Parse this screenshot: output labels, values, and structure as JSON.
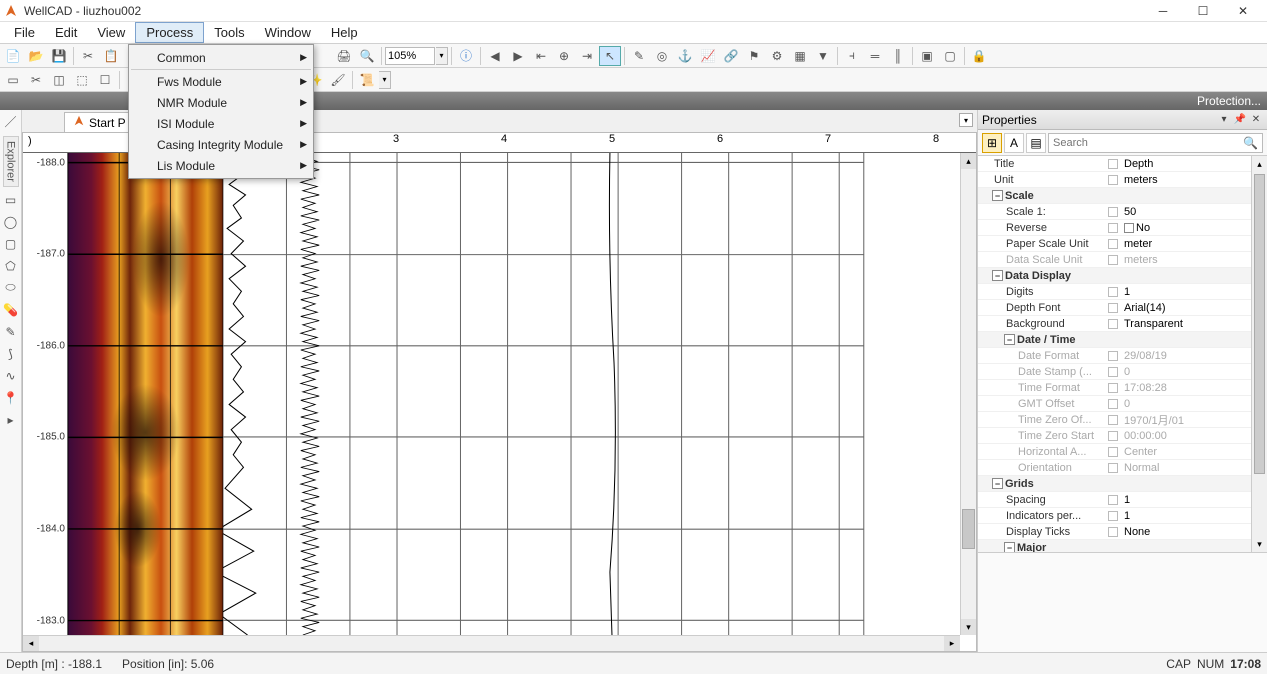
{
  "app": {
    "title": "WellCAD - liuzhou002"
  },
  "menubar": {
    "items": [
      "File",
      "Edit",
      "View",
      "Process",
      "Tools",
      "Window",
      "Help"
    ],
    "active": "Process"
  },
  "dropdown": {
    "items": [
      "Common",
      "Fws Module",
      "NMR Module",
      "ISI Module",
      "Casing Integrity Module",
      "Lis Module"
    ]
  },
  "zoom": {
    "value": "105%"
  },
  "tab": {
    "label": "Start P"
  },
  "protection": "Protection...",
  "ruler": {
    "ticks": [
      "3",
      "4",
      "5",
      "6",
      "7",
      "8"
    ]
  },
  "depths": [
    "-188.0",
    "-187.0",
    "-186.0",
    "-185.0",
    "-184.0",
    "-183.0"
  ],
  "properties": {
    "title": "Properties",
    "search_placeholder": "Search",
    "rows": {
      "title_k": "Title",
      "title_v": "Depth",
      "unit_k": "Unit",
      "unit_v": "meters",
      "scale_g": "Scale",
      "scale1_k": "Scale 1:",
      "scale1_v": "50",
      "reverse_k": "Reverse",
      "reverse_v": "No",
      "psu_k": "Paper Scale Unit",
      "psu_v": "meter",
      "dsu_k": "Data Scale Unit",
      "dsu_v": "meters",
      "dd_g": "Data Display",
      "digits_k": "Digits",
      "digits_v": "1",
      "df_k": "Depth Font",
      "df_v": "Arial(14)",
      "bg_k": "Background",
      "bg_v": "Transparent",
      "dt_g": "Date / Time",
      "datef_k": "Date Format",
      "datef_v": "29/08/19",
      "dstamp_k": "Date Stamp (...",
      "dstamp_v": "0",
      "timef_k": "Time Format",
      "timef_v": "17:08:28",
      "gmt_k": "GMT Offset",
      "gmt_v": "0",
      "tzo_k": "Time Zero Of...",
      "tzo_v": "1970/1月/01",
      "tzs_k": "Time Zero Start",
      "tzs_v": "00:00:00",
      "ha_k": "Horizontal A...",
      "ha_v": "Center",
      "orient_k": "Orientation",
      "orient_v": "Normal",
      "grids_g": "Grids",
      "spacing_k": "Spacing",
      "spacing_v": "1",
      "ind_k": "Indicators per...",
      "ind_v": "1",
      "dtk_k": "Display Ticks",
      "dtk_v": "None",
      "major_g": "Major"
    }
  },
  "status": {
    "depth": "Depth [m] : -188.1",
    "pos": "Position [in]:  5.06",
    "cap": "CAP",
    "num": "NUM",
    "time": "17:08"
  }
}
